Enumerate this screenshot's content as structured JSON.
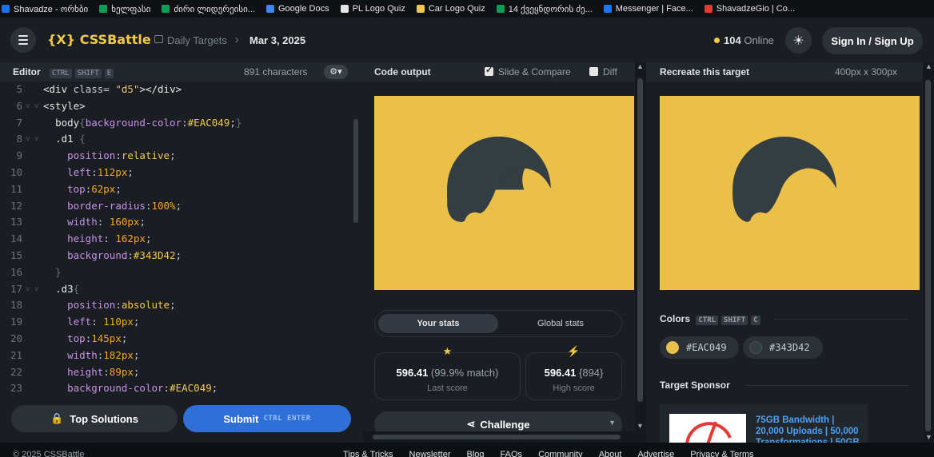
{
  "bookmarks": [
    {
      "label": "Shavadze - ორხბი",
      "color": "#1a73e8"
    },
    {
      "label": "ხელფასი",
      "color": "#0f9d58"
    },
    {
      "label": "ძირი ლიდერეისი...",
      "color": "#0f9d58"
    },
    {
      "label": "Google Docs",
      "color": "#4285f4"
    },
    {
      "label": "PL Logo Quiz",
      "color": "#e6e6e6"
    },
    {
      "label": "Car Logo Quiz",
      "color": "#f2c94c"
    },
    {
      "label": "14 ქვეყნდორის ძე...",
      "color": "#0f9d58"
    },
    {
      "label": "Messenger | Face...",
      "color": "#1877f2"
    },
    {
      "label": "ShavadzeGio | Co...",
      "color": "#e53935"
    }
  ],
  "header": {
    "logo_mark": "{X}",
    "logo_text": "CSSBattle",
    "crumb_daily": "Daily Targets",
    "crumb_sep": "›",
    "crumb_date": "Mar 3, 2025",
    "online_count": "104",
    "online_label": "Online",
    "theme_icon": "☀",
    "signin": "Sign In / Sign Up"
  },
  "editor": {
    "title": "Editor",
    "shortcut": [
      "CTRL",
      "SHIFT",
      "E"
    ],
    "chars": "891 characters",
    "settings_icon": "⚙▾",
    "lines": [
      {
        "n": "5",
        "fold": "",
        "html": "<span class='t-tag'>&lt;div</span> <span class='t-attr'>class=</span> <span class='t-str'>\"d5\"</span><span class='t-tag'>&gt;&lt;/div&gt;</span>"
      },
      {
        "n": "6",
        "fold": "v v",
        "html": "<span class='t-tag'>&lt;style&gt;</span>"
      },
      {
        "n": "7",
        "fold": "",
        "html": "  <span class='t-sel'>body</span><span class='t-brace'>{</span><span class='t-prop'>background-color</span>:<span class='t-val'>#EAC049</span>;<span class='t-brace'>}</span>"
      },
      {
        "n": "8",
        "fold": "v v",
        "html": "  <span class='t-sel'>.d1</span> <span class='t-brace'>{</span>"
      },
      {
        "n": "9",
        "fold": "",
        "html": "    <span class='t-prop'>position</span>:<span class='t-val'>relative</span>;"
      },
      {
        "n": "10",
        "fold": "",
        "html": "    <span class='t-prop'>left</span>:<span class='t-num'>112px</span>;"
      },
      {
        "n": "11",
        "fold": "",
        "html": "    <span class='t-prop'>top</span>:<span class='t-num'>62px</span>;"
      },
      {
        "n": "12",
        "fold": "",
        "html": "    <span class='t-prop'>border-radius</span>:<span class='t-num'>100%</span>;"
      },
      {
        "n": "13",
        "fold": "",
        "html": "    <span class='t-prop'>width</span>: <span class='t-num'>160px</span>;"
      },
      {
        "n": "14",
        "fold": "",
        "html": "    <span class='t-prop'>height</span>: <span class='t-num'>162px</span>;"
      },
      {
        "n": "15",
        "fold": "",
        "html": "    <span class='t-prop'>background</span>:<span class='t-val'>#343D42</span>;"
      },
      {
        "n": "16",
        "fold": "",
        "html": "  <span class='t-brace'>}</span>"
      },
      {
        "n": "17",
        "fold": "v v",
        "html": "  <span class='t-sel'>.d3</span><span class='t-brace'>{</span>"
      },
      {
        "n": "18",
        "fold": "",
        "html": "    <span class='t-prop'>position</span>:<span class='t-val'>absolute</span>;"
      },
      {
        "n": "19",
        "fold": "",
        "html": "    <span class='t-prop'>left</span>: <span class='t-num'>110px</span>;"
      },
      {
        "n": "20",
        "fold": "",
        "html": "    <span class='t-prop'>top</span>:<span class='t-num'>145px</span>;"
      },
      {
        "n": "21",
        "fold": "",
        "html": "    <span class='t-prop'>width</span>:<span class='t-num'>182px</span>;"
      },
      {
        "n": "22",
        "fold": "",
        "html": "    <span class='t-prop'>height</span>:<span class='t-num'>89px</span>;"
      },
      {
        "n": "23",
        "fold": "",
        "html": "    <span class='t-prop'>background-color</span>:<span class='t-val'>#EAC049</span>;"
      }
    ],
    "top_solutions": "Top Solutions",
    "submit": "Submit",
    "submit_shortcut": "CTRL  ENTER"
  },
  "output": {
    "title": "Code output",
    "slide_compare": "Slide & Compare",
    "diff": "Diff",
    "tab_your": "Your stats",
    "tab_global": "Global stats",
    "last_score": "596.41",
    "last_match": "(99.9% match)",
    "last_label": "Last score",
    "high_score": "596.41",
    "high_extra": "{894}",
    "high_label": "High score",
    "challenge": "Challenge"
  },
  "target": {
    "title": "Recreate this target",
    "size": "400px x 300px",
    "colors_label": "Colors",
    "colors_shortcut": [
      "CTRL",
      "SHIFT",
      "C"
    ],
    "color1": "#EAC049",
    "color2": "#343D42",
    "sponsor_label": "Target Sponsor",
    "sponsor_text": "75GB Bandwidth | 20,000 Uploads | 50,000 Transformations | 50GB"
  },
  "footer": {
    "copyright": "© 2025 CSSBattle",
    "links": [
      "Tips & Tricks",
      "Newsletter",
      "Blog",
      "FAQs",
      "Community",
      "About",
      "Advertise",
      "Privacy & Terms"
    ]
  }
}
